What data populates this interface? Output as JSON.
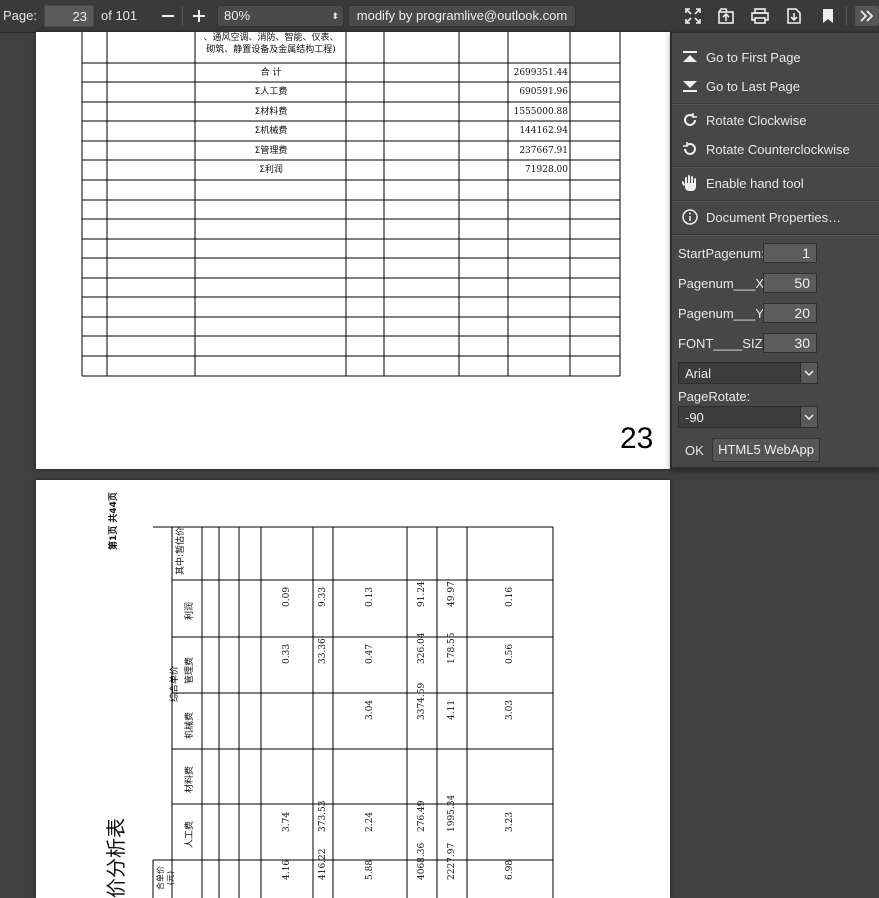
{
  "toolbar": {
    "page_label": "Page:",
    "page_value": "23",
    "page_of": "of 101",
    "zoom_value": "80%",
    "credit": "modify by programlive@outlook.com",
    "icons": [
      "zoom-out-icon",
      "zoom-in-icon",
      "fullscreen-icon",
      "open-file-icon",
      "print-icon",
      "download-icon",
      "bookmark-icon",
      "tools-chevron-icon"
    ]
  },
  "page1": {
    "header_text": "、通风空调、消防、智能、仪表、\n砌筑、静置设备及金属结构工程)",
    "summary_rows": [
      {
        "label": "合    计",
        "value": "2699351.44"
      },
      {
        "label": "Σ人工费",
        "value": "690591.96"
      },
      {
        "label": "Σ材料费",
        "value": "1555000.88"
      },
      {
        "label": "Σ机械费",
        "value": "144162.94"
      },
      {
        "label": "Σ管理费",
        "value": "237667.91"
      },
      {
        "label": "Σ利润",
        "value": "71928.00"
      }
    ],
    "page_number": "23"
  },
  "page2": {
    "page_info": "第1页 共44页",
    "title_fragment": "价分析表",
    "headers": {
      "group": "综合单价",
      "zh": "其中:暂估价",
      "lirun": "利润",
      "guanli": "管理费",
      "jixie": "机械费",
      "cailiao": "材料费",
      "rengong": "人工费",
      "unit_price": "合单价(元)"
    },
    "columns": [
      {
        "lirun": "0.09",
        "guanli": "0.33",
        "jixie": "",
        "rengong": "3.74",
        "unit": "4.16"
      },
      {
        "lirun": "9.33",
        "guanli": "33.36",
        "jixie": "",
        "rengong": "373.53",
        "unit": "416.22"
      },
      {
        "lirun": "0.13",
        "guanli": "0.47",
        "jixie": "3.04",
        "rengong": "2.24",
        "unit": "5.88"
      },
      {
        "lirun": "91.24",
        "guanli": "326.04",
        "jixie": "3374.59",
        "rengong": "276.49",
        "unit": "4068.36"
      },
      {
        "lirun": "49.97",
        "guanli": "178.55",
        "jixie": "4.11",
        "rengong": "1995.34",
        "unit": "2227.97"
      },
      {
        "lirun": "0.16",
        "guanli": "0.56",
        "jixie": "3.03",
        "rengong": "3.23",
        "unit": "6.98"
      }
    ]
  },
  "menu": {
    "items": [
      {
        "label": "Go to First Page",
        "icon": "first-page-icon"
      },
      {
        "label": "Go to Last Page",
        "icon": "last-page-icon"
      },
      {
        "label": "Rotate Clockwise",
        "icon": "rotate-cw-icon"
      },
      {
        "label": "Rotate Counterclockwise",
        "icon": "rotate-ccw-icon"
      },
      {
        "label": "Enable hand tool",
        "icon": "hand-icon"
      },
      {
        "label": "Document Properties…",
        "icon": "info-icon"
      }
    ],
    "fields": {
      "start_label": "StartPagenum:",
      "start_value": "1",
      "x_label": "Pagenum___X:",
      "x_value": "50",
      "y_label": "Pagenum___Y:",
      "y_value": "20",
      "size_label": "FONT____SIZE:",
      "size_value": "30",
      "font_value": "Arial",
      "rotate_label": "PageRotate:",
      "rotate_value": "-90",
      "ok_label": "OK",
      "webapp_label": "HTML5 WebApp"
    }
  },
  "colors": {
    "toolbar": "#3a3a3a",
    "background": "#404040",
    "menu": "#474747"
  }
}
